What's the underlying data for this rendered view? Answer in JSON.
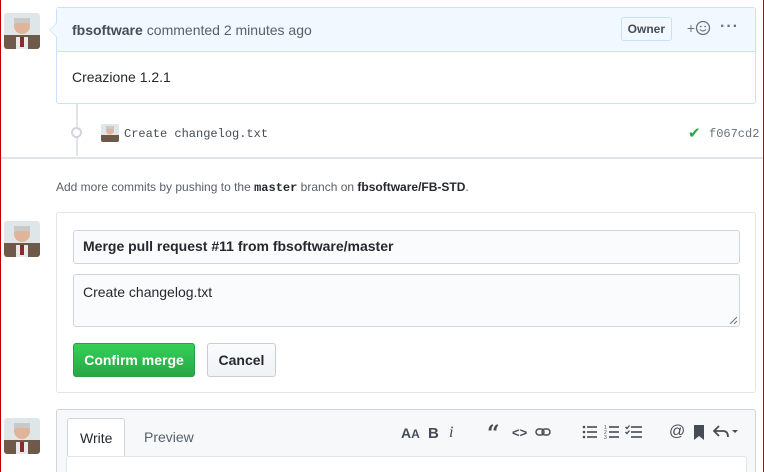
{
  "comment": {
    "author": "fbsoftware",
    "action": "commented",
    "time": "2 minutes ago",
    "badge": "Owner",
    "emoji_label": "+",
    "body": "Creazione 1.2.1"
  },
  "commit": {
    "message": "Create changelog.txt",
    "sha": "f067cd2",
    "status_icon": "check-icon"
  },
  "hint": {
    "prefix": "Add more commits by pushing to the",
    "branch": "master",
    "middle": "branch on",
    "repo": "fbsoftware/FB-STD",
    "suffix": "."
  },
  "merge": {
    "title_value": "Merge pull request #11 from fbsoftware/master",
    "message_value": "Create changelog.txt",
    "confirm_label": "Confirm merge",
    "cancel_label": "Cancel"
  },
  "editor": {
    "tabs": [
      "Write",
      "Preview"
    ],
    "toolbar_icons": [
      "text-size-icon",
      "bold-icon",
      "italic-icon",
      "quote-icon",
      "code-icon",
      "link-icon",
      "bulleted-list-icon",
      "numbered-list-icon",
      "task-list-icon",
      "mention-icon",
      "saved-reply-icon",
      "reply-icon"
    ]
  },
  "colors": {
    "accent_green": "#28a745",
    "header_bg": "#f1f8ff",
    "border_blue": "#c8e1ff"
  }
}
